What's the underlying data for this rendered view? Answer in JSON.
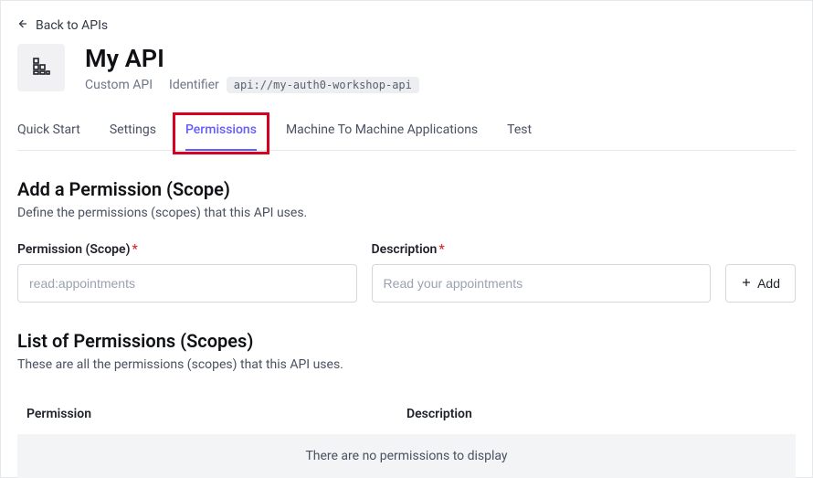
{
  "back_label": "Back to APIs",
  "api": {
    "title": "My API",
    "subtitle": "Custom API",
    "identifier_label": "Identifier",
    "identifier_value": "api://my-auth0-workshop-api"
  },
  "tabs": {
    "quick_start": "Quick Start",
    "settings": "Settings",
    "permissions": "Permissions",
    "m2m": "Machine To Machine Applications",
    "test": "Test"
  },
  "add_section": {
    "title": "Add a Permission (Scope)",
    "desc": "Define the permissions (scopes) that this API uses.",
    "scope_label": "Permission (Scope)",
    "scope_placeholder": "read:appointments",
    "desc_label": "Description",
    "desc_placeholder": "Read your appointments",
    "add_button": "Add"
  },
  "list_section": {
    "title": "List of Permissions (Scopes)",
    "desc": "These are all the permissions (scopes) that this API uses.",
    "col_permission": "Permission",
    "col_description": "Description",
    "empty": "There are no permissions to display"
  }
}
